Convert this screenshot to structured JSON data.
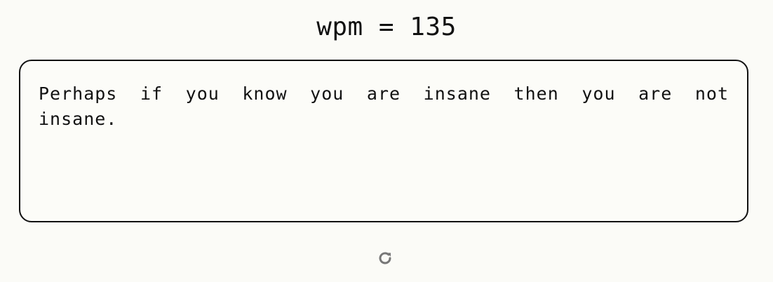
{
  "header": {
    "wpm_text": "wpm = 135"
  },
  "passage": {
    "text": "Perhaps if you know you are insane then you are not insane."
  },
  "controls": {
    "restart_icon": "refresh-icon"
  },
  "colors": {
    "background": "#fbfbf7",
    "text": "#111111",
    "icon": "#777777"
  }
}
